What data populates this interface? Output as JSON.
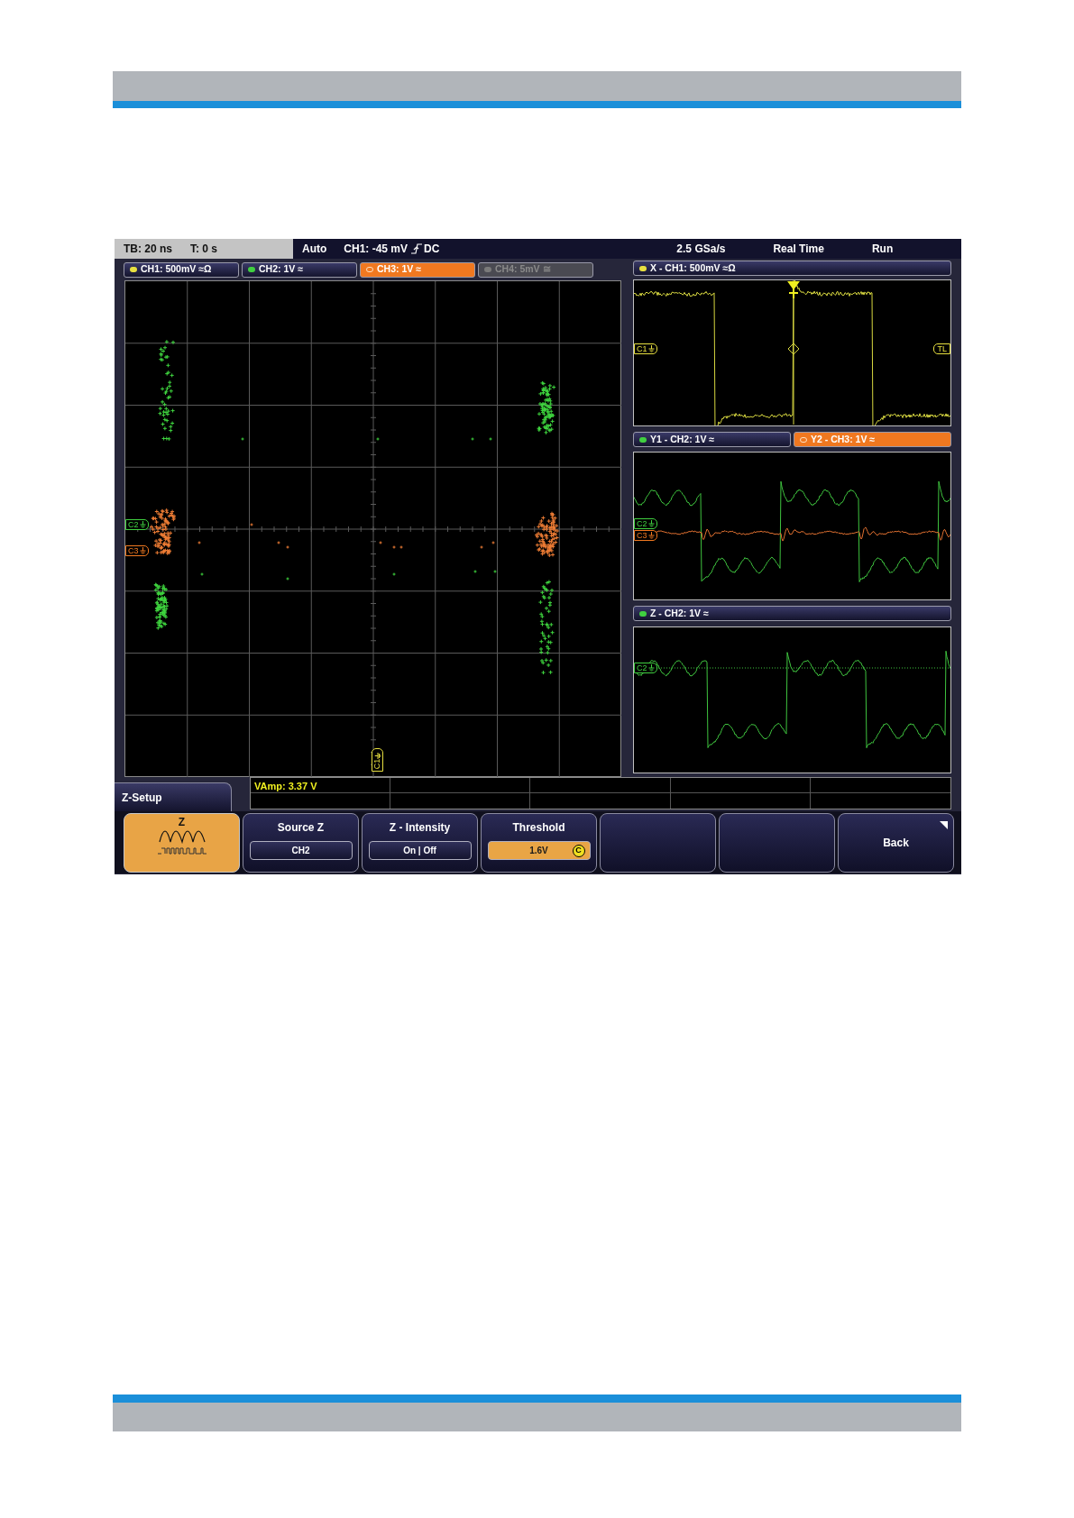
{
  "status_bar": {
    "timebase": "TB: 20 ns",
    "trigger_offset": "T: 0 s",
    "trigger_mode": "Auto",
    "trigger_level": "CH1: -45 mV",
    "trigger_coupling": "DC",
    "sample_rate": "2.5 GSa/s",
    "acquisition_mode": "Real Time",
    "run_state": "Run"
  },
  "channel_tabs": [
    {
      "label": "CH1: 500mV ≈Ω",
      "color": "#e8e040",
      "selected": false,
      "disabled": false
    },
    {
      "label": "CH2: 1V ≈",
      "color": "#40d040",
      "selected": false,
      "disabled": false
    },
    {
      "label": "CH3: 1V ≈",
      "color": "#f07820",
      "selected": true,
      "disabled": false
    },
    {
      "label": "CH4: 5mV ≅",
      "color": "#7a7a7a",
      "selected": false,
      "disabled": true
    }
  ],
  "xy_plot": {
    "markers": [
      {
        "label": "C2",
        "color": "#40d040"
      },
      {
        "label": "C3",
        "color": "#f07820"
      },
      {
        "label": "C1",
        "color": "#e8e040"
      }
    ]
  },
  "x_panel": {
    "tab": {
      "label": "X - CH1: 500mV ≈Ω",
      "color": "#e8e040",
      "selected": false
    },
    "markers": [
      {
        "label": "C1",
        "kind": "channel"
      },
      {
        "label": "TL",
        "kind": "trigger"
      }
    ]
  },
  "y_panel": {
    "tabs": [
      {
        "label": "Y1 - CH2: 1V ≈",
        "color": "#40d040",
        "selected": false
      },
      {
        "label": "Y2 - CH3: 1V ≈",
        "color": "#f07820",
        "selected": true
      }
    ],
    "markers": [
      {
        "label": "C2",
        "color": "#40d040"
      },
      {
        "label": "C3",
        "color": "#f07820"
      }
    ]
  },
  "z_panel": {
    "tab": {
      "label": "Z - CH2: 1V ≈",
      "color": "#40d040",
      "selected": false
    },
    "markers": [
      {
        "label": "C2",
        "color": "#40d040"
      }
    ]
  },
  "measurement": "VAmp: 3.37 V",
  "menu": {
    "title": "Z-Setup",
    "icon_label": "Z",
    "softkeys": [
      {
        "kind": "setting",
        "label": "Source Z",
        "value": "CH2",
        "active": false
      },
      {
        "kind": "setting",
        "label": "Z - Intensity",
        "value": "On | Off",
        "active": false
      },
      {
        "kind": "setting",
        "label": "Threshold",
        "value": "1.6V",
        "active": true,
        "knob": "C"
      },
      {
        "kind": "empty"
      },
      {
        "kind": "empty"
      },
      {
        "kind": "back",
        "label": "Back"
      }
    ]
  }
}
